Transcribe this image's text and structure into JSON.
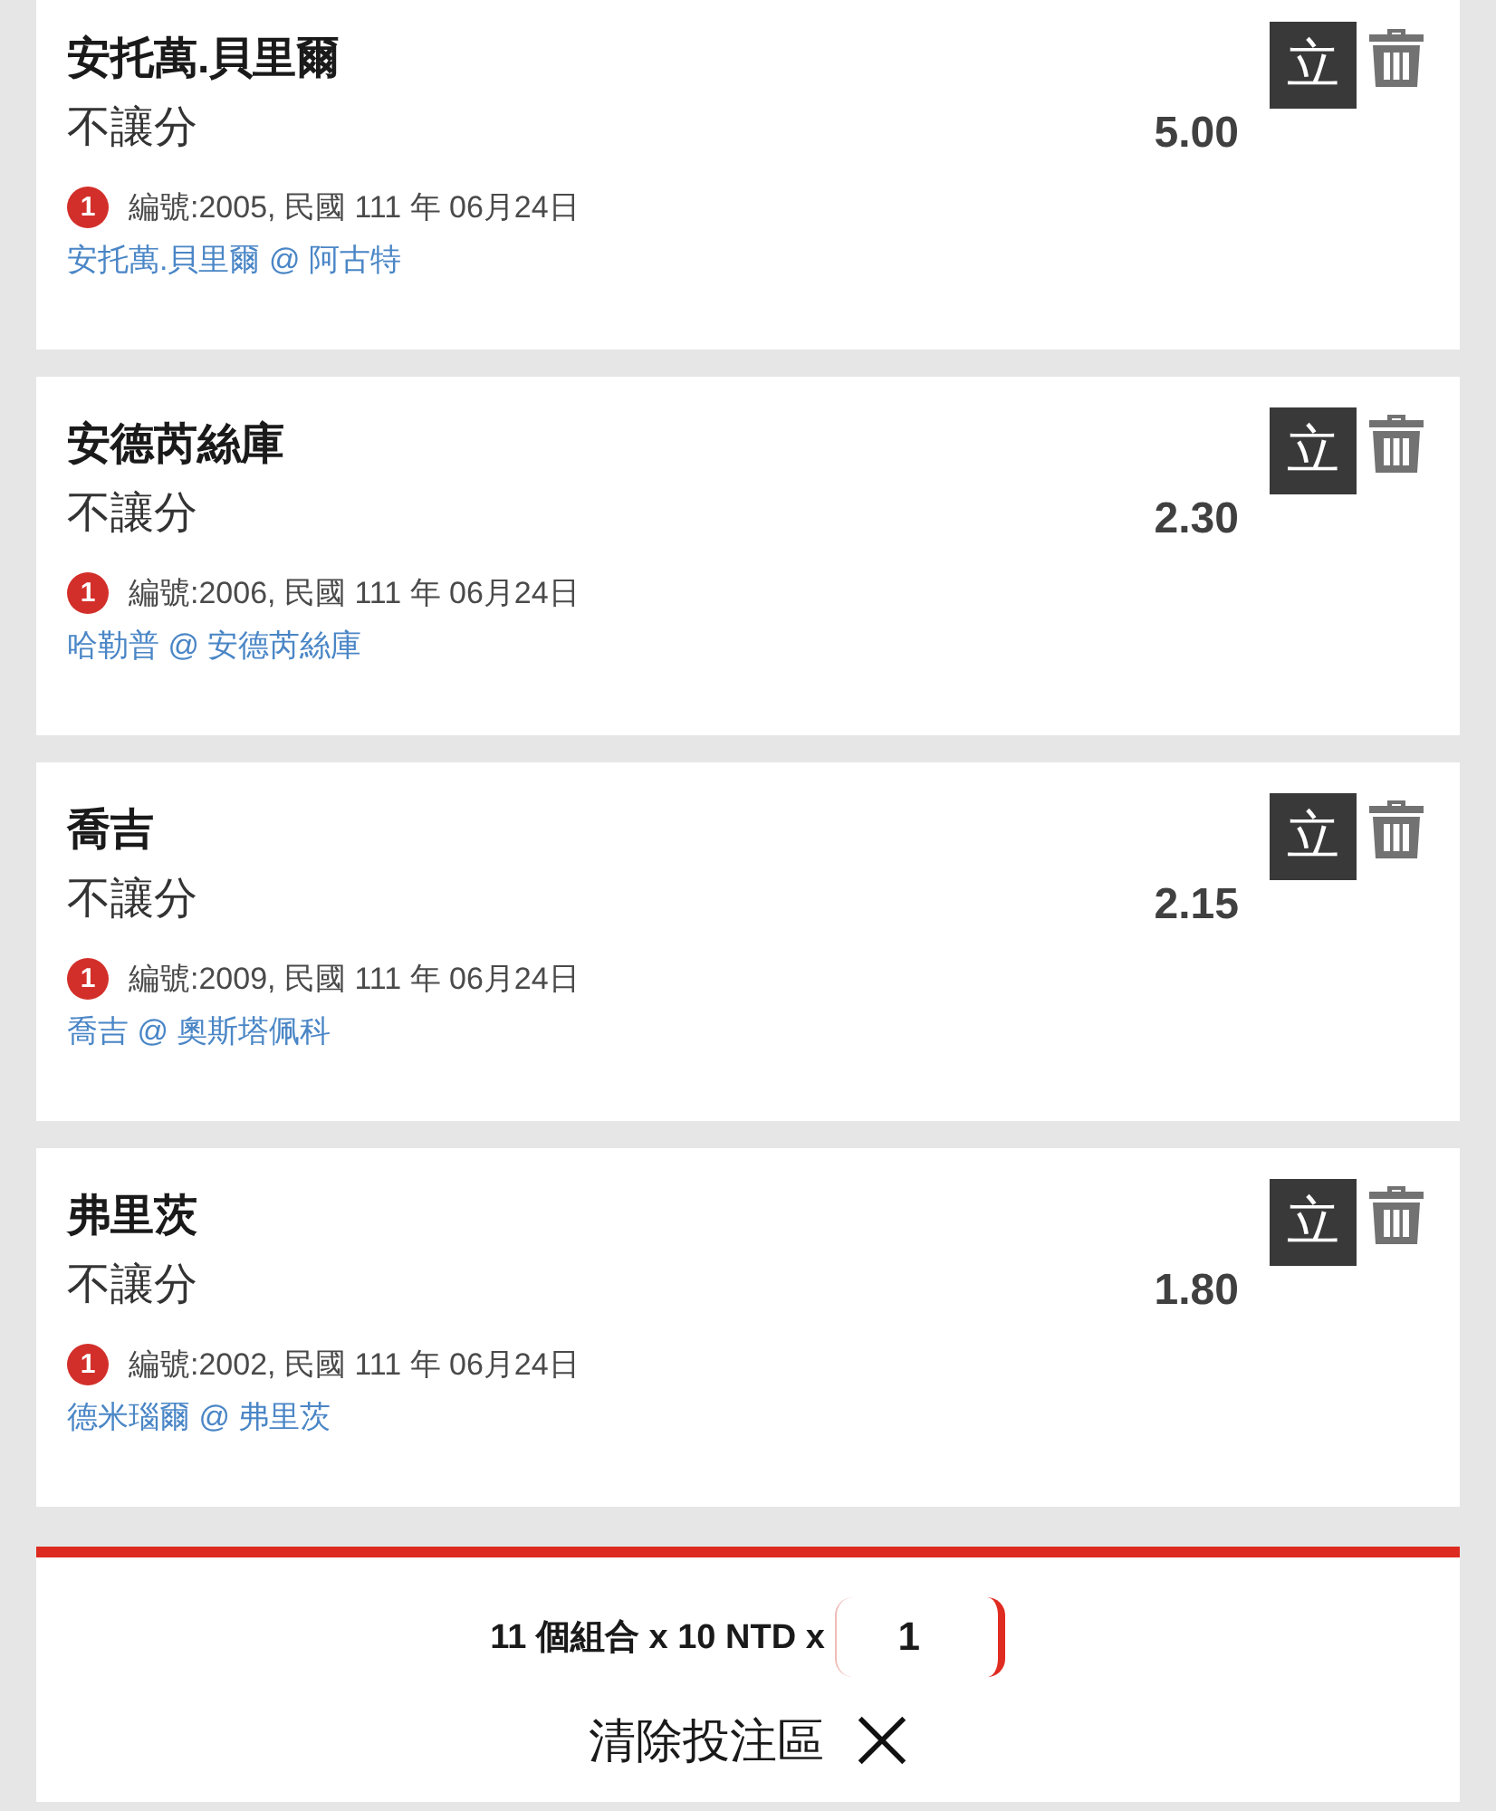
{
  "bets": [
    {
      "name": "安托萬.貝里爾",
      "bet_type": "不讓分",
      "odds": "5.00",
      "action_label": "立",
      "badge": "1",
      "info": "編號:2005, 民國 111 年 06月24日",
      "match": "安托萬.貝里爾 @ 阿古特"
    },
    {
      "name": "安德芮絲庫",
      "bet_type": "不讓分",
      "odds": "2.30",
      "action_label": "立",
      "badge": "1",
      "info": "編號:2006, 民國 111 年 06月24日",
      "match": "哈勒普 @ 安德芮絲庫"
    },
    {
      "name": "喬吉",
      "bet_type": "不讓分",
      "odds": "2.15",
      "action_label": "立",
      "badge": "1",
      "info": "編號:2009, 民國 111 年 06月24日",
      "match": "喬吉 @ 奧斯塔佩科"
    },
    {
      "name": "弗里茨",
      "bet_type": "不讓分",
      "odds": "1.80",
      "action_label": "立",
      "badge": "1",
      "info": "編號:2002, 民國 111 年 06月24日",
      "match": "德米瑙爾 @ 弗里茨"
    }
  ],
  "summary": {
    "text": "11 個組合 x 10 NTD x",
    "multiplier": "1"
  },
  "clear_button": {
    "label": "清除投注區"
  }
}
